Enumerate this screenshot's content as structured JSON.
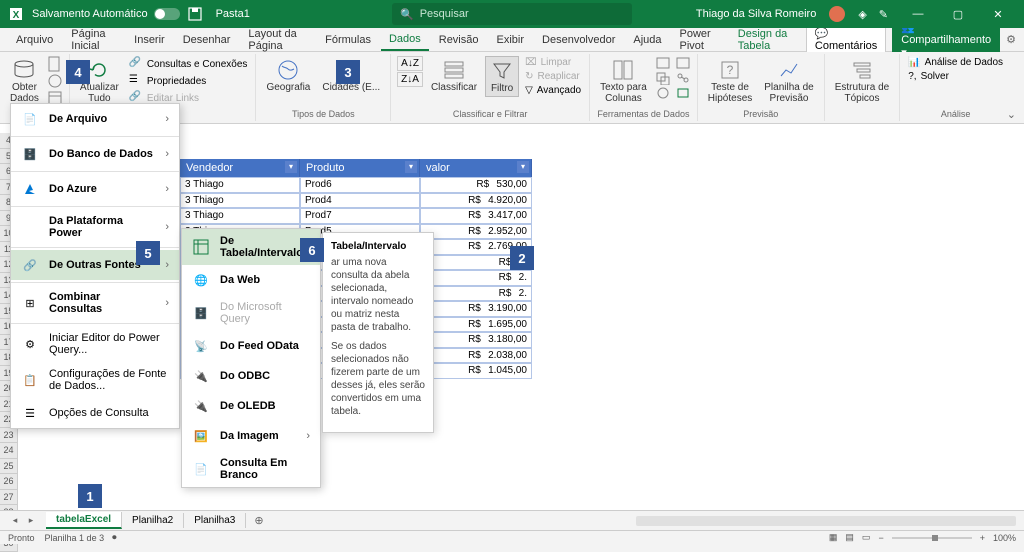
{
  "titlebar": {
    "autosave": "Salvamento Automático",
    "filename": "Pasta1",
    "search_placeholder": "Pesquisar",
    "username": "Thiago da Silva Romeiro"
  },
  "menutabs": {
    "tabs": [
      "Arquivo",
      "Página Inicial",
      "Inserir",
      "Desenhar",
      "Layout da Página",
      "Fórmulas",
      "Dados",
      "Revisão",
      "Exibir",
      "Desenvolvedor",
      "Ajuda",
      "Power Pivot",
      "Design da Tabela"
    ],
    "active_index": 6,
    "comments": "Comentários",
    "share": "Compartilhamento"
  },
  "ribbon": {
    "obter_dados": "Obter\nDados",
    "atualizar": "Atualizar\nTudo",
    "consultas_conexoes": "Consultas e Conexões",
    "propriedades": "Propriedades",
    "editar_links": "Editar Links",
    "geografia": "Geografia",
    "cidades": "Cidades (E...",
    "classificar": "Classificar",
    "filtro": "Filtro",
    "limpar": "Limpar",
    "reaplicar": "Reaplicar",
    "avancado": "Avançado",
    "texto_colunas": "Texto para\nColunas",
    "teste_hipoteses": "Teste de\nHipóteses",
    "planilha_previsao": "Planilha de\nPrevisão",
    "estrutura_topicos": "Estrutura de\nTópicos",
    "analise_dados": "Análise de Dados",
    "solver": "Solver",
    "group_conexoes": "nexões",
    "group_tipos": "Tipos de Dados",
    "group_classificar": "Classificar e Filtrar",
    "group_ferramentas": "Ferramentas de Dados",
    "group_previsao": "Previsão",
    "group_analise": "Análise"
  },
  "menu1": {
    "items": [
      {
        "label": "De Arquivo",
        "icon": "file",
        "arrow": true
      },
      {
        "label": "Do Banco de Dados",
        "icon": "db",
        "arrow": true
      },
      {
        "label": "Do Azure",
        "icon": "azure",
        "arrow": true
      },
      {
        "label": "Da Plataforma Power",
        "icon": "",
        "arrow": true
      },
      {
        "label": "De Outras Fontes",
        "icon": "other",
        "arrow": true,
        "highlighted": true
      },
      {
        "label": "Combinar Consultas",
        "icon": "combine",
        "arrow": true
      }
    ],
    "bottom": [
      "Iniciar Editor do Power Query...",
      "Configurações de Fonte de Dados...",
      "Opções de Consulta"
    ]
  },
  "menu2": {
    "items": [
      {
        "label": "De Tabela/Intervalo",
        "highlighted": true
      },
      {
        "label": "Da Web"
      },
      {
        "label": "Do Microsoft Query",
        "disabled": true
      },
      {
        "label": "Do Feed OData"
      },
      {
        "label": "Do ODBC"
      },
      {
        "label": "De OLEDB"
      },
      {
        "label": "Da Imagem",
        "arrow": true
      },
      {
        "label": "Consulta Em Branco"
      }
    ]
  },
  "tooltip": {
    "title": "Tabela/Intervalo",
    "body1": "ar uma nova consulta da abela selecionada, intervalo nomeado ou matriz nesta pasta de trabalho.",
    "body2": "Se os dados selecionados não fizerem parte de um desses já, eles serão convertidos em uma tabela."
  },
  "table": {
    "headers": [
      "Vendedor",
      "Produto",
      "valor"
    ],
    "currency": "R$",
    "rows": [
      {
        "id": "3",
        "vend": "Thiago",
        "prod": "Prod6",
        "val": "530,00"
      },
      {
        "id": "3",
        "vend": "Thiago",
        "prod": "Prod4",
        "val": "4.920,00"
      },
      {
        "id": "3",
        "vend": "Thiago",
        "prod": "Prod7",
        "val": "3.417,00"
      },
      {
        "id": "3",
        "vend": "Thiago",
        "prod": "Prod5",
        "val": "2.952,00"
      },
      {
        "id": "",
        "vend": "",
        "prod": "",
        "val": "2.769,00"
      },
      {
        "id": "",
        "vend": "",
        "prod": "",
        "val": "1."
      },
      {
        "id": "",
        "vend": "",
        "prod": "",
        "val": "2."
      },
      {
        "id": "",
        "vend": "",
        "prod": "",
        "val": "2."
      },
      {
        "id": "",
        "vend": "",
        "prod": "",
        "val": "3.190,00"
      },
      {
        "id": "",
        "vend": "",
        "prod": "",
        "val": "1.695,00"
      },
      {
        "id": "",
        "vend": "",
        "prod": "",
        "val": "3.180,00"
      },
      {
        "id": "",
        "vend": "",
        "prod": "",
        "val": "2.038,00"
      },
      {
        "id": "",
        "vend": "",
        "prod": "",
        "val": "1.045,00"
      }
    ]
  },
  "sheets": {
    "tabs": [
      "tabelaExcel",
      "Planilha2",
      "Planilha3"
    ],
    "active_index": 0
  },
  "statusbar": {
    "ready": "Pronto",
    "sheet_info": "Planilha 1 de 3",
    "zoom": "100%"
  },
  "annotations": [
    "1",
    "2",
    "3",
    "4",
    "5",
    "6"
  ]
}
